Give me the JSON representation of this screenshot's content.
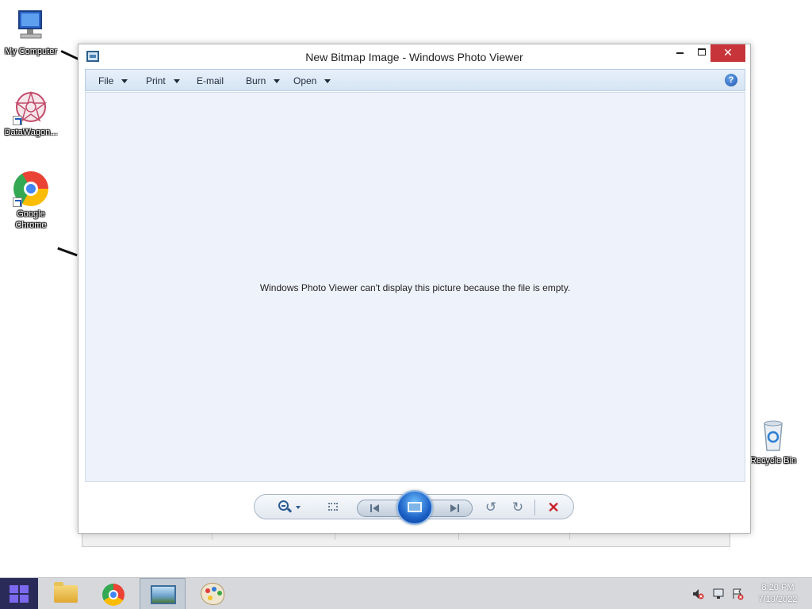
{
  "desktop": {
    "icons": [
      {
        "label": "My Computer"
      },
      {
        "label": "DataWagon..."
      },
      {
        "label": "Google Chrome"
      },
      {
        "label": "Recycle Bin"
      }
    ]
  },
  "window": {
    "title": "New Bitmap Image - Windows Photo Viewer",
    "close_glyph": "✕",
    "menu": {
      "file": "File",
      "print": "Print",
      "email": "E-mail",
      "burn": "Burn",
      "open": "Open",
      "help_glyph": "?"
    },
    "message": "Windows Photo Viewer can't display this picture because the file is empty."
  },
  "toolbar": {
    "icons": [
      "zoom-icon",
      "actual-size-icon",
      "previous-icon",
      "slideshow-icon",
      "next-icon",
      "rotate-left-icon",
      "rotate-right-icon",
      "delete-icon"
    ],
    "rotate_left_glyph": "↺",
    "rotate_right_glyph": "↻",
    "delete_glyph": "✕"
  },
  "taskbar": {
    "apps": [
      "file-explorer",
      "google-chrome",
      "windows-photo-viewer",
      "paint"
    ],
    "active_app": "windows-photo-viewer",
    "clock_time": "8:20 PM",
    "clock_date": "7/19/2022"
  },
  "colors": {
    "close_button": "#c7353a",
    "viewer_background": "#eef2fb",
    "start_button": "#2b2b5a"
  }
}
